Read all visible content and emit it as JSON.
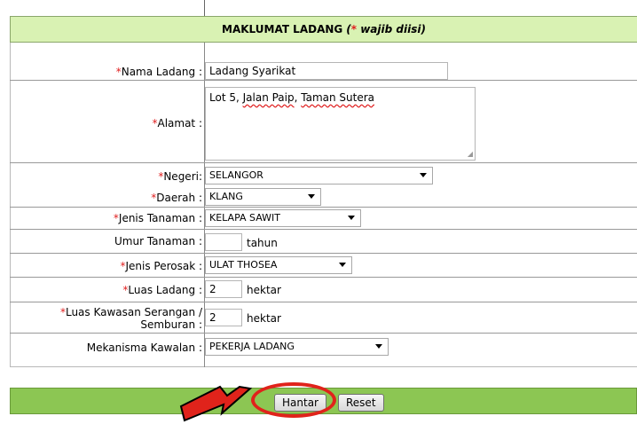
{
  "header": {
    "title": "MAKLUMAT LADANG",
    "hint_open": "(",
    "hint_star": "*",
    "hint_text": "wajib diisi)"
  },
  "form": {
    "nama_ladang": {
      "label": "Nama Ladang :",
      "value": "Ladang Syarikat",
      "required": "*"
    },
    "alamat": {
      "label": "Alamat :",
      "value_part1": "Lot 5, ",
      "value_part2": "Jalan Paip",
      "value_part3": ", ",
      "value_part4": "Taman Sutera",
      "required": "*"
    },
    "negeri": {
      "label": "Negeri:",
      "value": "SELANGOR",
      "required": "*"
    },
    "daerah": {
      "label": "Daerah :",
      "value": "KLANG",
      "required": "*"
    },
    "jenis_tanaman": {
      "label": "Jenis Tanaman :",
      "value": "KELAPA SAWIT",
      "required": "*"
    },
    "umur_tanaman": {
      "label": "Umur Tanaman :",
      "value": "",
      "unit": "tahun"
    },
    "jenis_perosak": {
      "label": "Jenis Perosak :",
      "value": "ULAT THOSEA",
      "required": "*"
    },
    "luas_ladang": {
      "label": "Luas Ladang :",
      "value": "2",
      "unit": "hektar",
      "required": "*"
    },
    "luas_kawasan": {
      "label": "Luas Kawasan Serangan / Semburan :",
      "value": "2",
      "unit": "hektar",
      "required": "*"
    },
    "mekanisma": {
      "label": "Mekanisma Kawalan :",
      "value": "PEKERJA LADANG"
    }
  },
  "buttons": {
    "submit": "Hantar",
    "reset": "Reset"
  },
  "colors": {
    "header_bg": "#d9f2b3",
    "footer_bg": "#8cc653",
    "required": "#e02020",
    "annotation": "#e0231b"
  }
}
